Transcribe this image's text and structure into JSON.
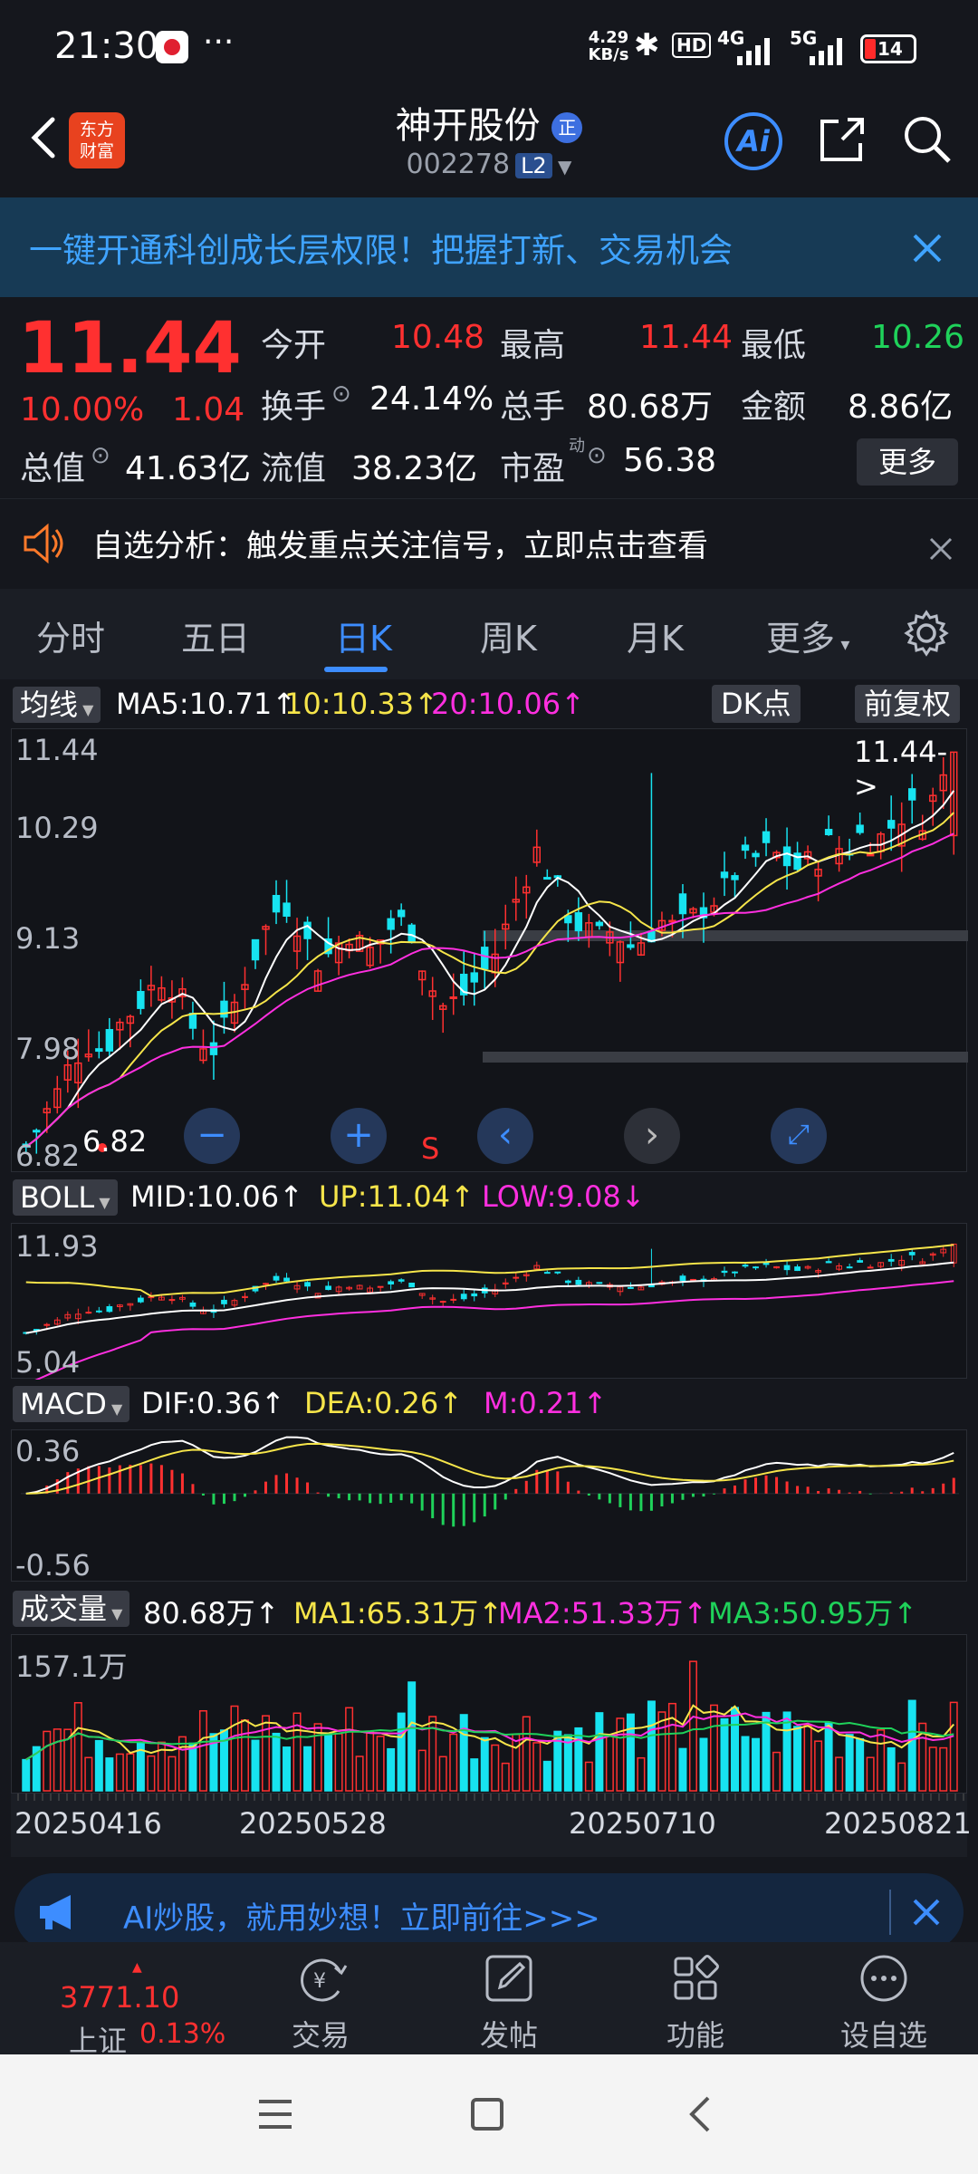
{
  "status_bar": {
    "time": "21:30",
    "net_speed": "4.29\nKB/s",
    "signal1": "4G",
    "signal2": "5G",
    "battery": "14"
  },
  "header": {
    "logo_line1": "东方",
    "logo_line2": "财富",
    "stock_name": "神开股份",
    "badge": "正",
    "stock_code": "002278",
    "level": "L2",
    "ai_label": "Ai"
  },
  "promo": {
    "text": "一键开通科创成长层权限！把握打新、交易机会"
  },
  "quote": {
    "price": "11.44",
    "change_pct": "10.00%",
    "change_amt": "1.04",
    "open_label": "今开",
    "open": "10.48",
    "high_label": "最高",
    "high": "11.44",
    "low_label": "最低",
    "low": "10.26",
    "turnover_label": "换手",
    "turnover": "24.14%",
    "volume_label": "总手",
    "volume": "80.68万",
    "amount_label": "金额",
    "amount": "8.86亿",
    "mktcap_label": "总值",
    "mktcap": "41.63亿",
    "float_label": "流值",
    "float_cap": "38.23亿",
    "pe_label": "市盈",
    "pe_sup": "动",
    "pe": "56.38",
    "more_label": "更多"
  },
  "alert": {
    "text": "自选分析：触发重点关注信号，立即点击查看"
  },
  "tabs": [
    "分时",
    "五日",
    "日K",
    "周K",
    "月K",
    "更多"
  ],
  "kline": {
    "selector": "均线",
    "ma5": "MA5:10.71↑",
    "ma10": "10:10.33↑",
    "ma20": "20:10.06↑",
    "dk": "DK点",
    "adjust": "前复权",
    "y_top": "11.44",
    "y2": "10.29",
    "y3": "9.13",
    "y4": "7.98",
    "y_bottom": "6.82",
    "last_tag": "11.44->",
    "low_tag": "6.82",
    "s_mark": "S"
  },
  "boll": {
    "selector": "BOLL",
    "mid": "MID:10.06↑",
    "up": "UP:11.04↑",
    "low": "LOW:9.08↓",
    "y_top": "11.93",
    "y_bottom": "5.04"
  },
  "macd": {
    "selector": "MACD",
    "dif": "DIF:0.36↑",
    "dea": "DEA:0.26↑",
    "m": "M:0.21↑",
    "y_top": "0.36",
    "y_bottom": "-0.56"
  },
  "volume": {
    "selector": "成交量",
    "vol": "80.68万↑",
    "ma1": "MA1:65.31万↑",
    "ma2": "MA2:51.33万↑",
    "ma3": "MA3:50.95万↑",
    "y_top": "157.1万"
  },
  "dates": [
    "20250416",
    "20250528",
    "20250710",
    "20250821"
  ],
  "ad": {
    "text": "AI炒股，就用妙想！立即前往>>>"
  },
  "nav": {
    "index_value": "3771.10",
    "index_name": "上证",
    "index_pct": "0.13%",
    "trade": "交易",
    "post": "发帖",
    "function": "功能",
    "watch": "设自选"
  },
  "colors": {
    "up": "#ff3030",
    "down": "#1fd25a",
    "cyan": "#17e3f0",
    "ma10": "#f6e54a",
    "ma20": "#ff2fe0",
    "accent": "#3d8dff"
  }
}
